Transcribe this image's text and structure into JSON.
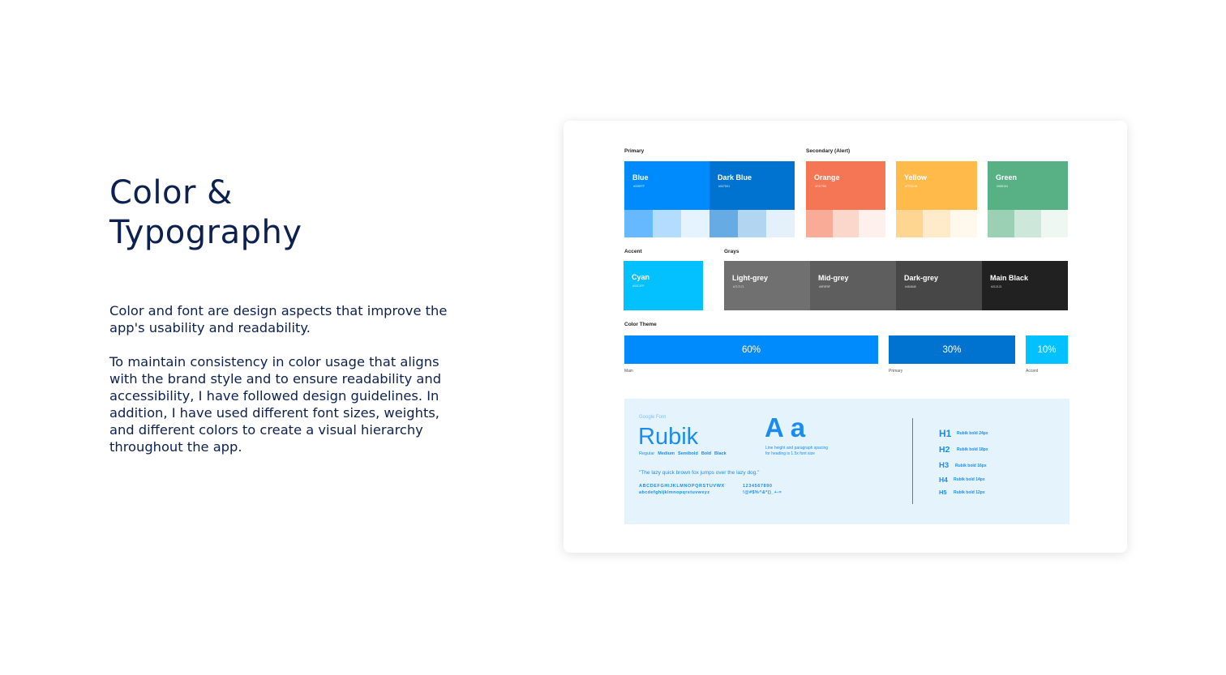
{
  "heading": "Color &\nTypography",
  "paragraphs": [
    "Color and font are design aspects that improve the app's usability and readability.",
    "To maintain consistency in color usage that aligns with the brand style and to ensure readability and accessibility, I have followed design guidelines. In addition, I have used different font sizes, weights, and different colors to create a visual hierarchy throughout the app."
  ],
  "card": {
    "primary_label": "Primary",
    "secondary_label": "Secondary (Alert)",
    "primary": [
      {
        "name": "Blue",
        "code": "#008FFF",
        "color": "#008bfd",
        "tints": [
          "#66b9fe",
          "#b3dcfe",
          "#e5f3fe"
        ]
      },
      {
        "name": "Dark Blue",
        "code": "#0075D1",
        "color": "#0073d1",
        "tints": [
          "#66abe3",
          "#b2d5f1",
          "#e5f1fa"
        ]
      }
    ],
    "secondary": [
      {
        "name": "Orange",
        "code": "#F47755",
        "color": "#f47654",
        "tints": [
          "#f8ac98",
          "#fbd6cb",
          "#fef1ed"
        ]
      },
      {
        "name": "Yellow",
        "code": "#FFBA4B",
        "color": "#ffba4a",
        "tints": [
          "#ffd592",
          "#ffeac9",
          "#fff8ec"
        ]
      },
      {
        "name": "Green",
        "code": "#58B184",
        "color": "#58b184",
        "tints": [
          "#9bd0b5",
          "#cde7da",
          "#eef7f2"
        ]
      }
    ],
    "accent_label": "Accent",
    "accent": {
      "name": "Cyan",
      "code": "#03C1FF",
      "color": "#03c0fe"
    },
    "grays_label": "Grays",
    "grays": [
      {
        "name": "Light-grey",
        "code": "#717171",
        "color": "#707070"
      },
      {
        "name": "Mid-grey",
        "code": "#5F5F5F",
        "color": "#5e5e5e"
      },
      {
        "name": "Dark-grey",
        "code": "#484848",
        "color": "#474747"
      },
      {
        "name": "Main Black",
        "code": "#212121",
        "color": "#212121"
      }
    ],
    "theme_label": "Color Theme",
    "theme": [
      {
        "percent": "60%",
        "caption": "Main",
        "color": "#008bfd"
      },
      {
        "percent": "30%",
        "caption": "Primary",
        "color": "#0073d1"
      },
      {
        "percent": "10%",
        "caption": "Accent",
        "color": "#03c0fe"
      }
    ],
    "typography": {
      "google_font_label": "Google Font",
      "font_name": "Rubik",
      "weights": [
        "Regular",
        "Medium",
        "Semibold",
        "Bold",
        "Black"
      ],
      "aa": "A a",
      "line_height_note": "Line height and paragraph spacing\nfor heading is 1.5x font size",
      "pangram": "\"The lazy quick brown fox jumps over the lazy dog.\"",
      "uppercase": "ABCDEFGHIJKLMNOPQRSTUVWX",
      "lowercase": "abcdefghijklmnopqrstuvwxyz",
      "digits": "1234567890",
      "symbols": "!@#$%^&*()_+-=",
      "headings": [
        {
          "tag": "H1",
          "desc": "Rubik bold 24px"
        },
        {
          "tag": "H2",
          "desc": "Rubik bold 18px"
        },
        {
          "tag": "H3",
          "desc": "Rubik bold 16px"
        },
        {
          "tag": "H4",
          "desc": "Rubik bold 14px"
        },
        {
          "tag": "H5",
          "desc": "Rubik bold 12px"
        }
      ]
    }
  }
}
